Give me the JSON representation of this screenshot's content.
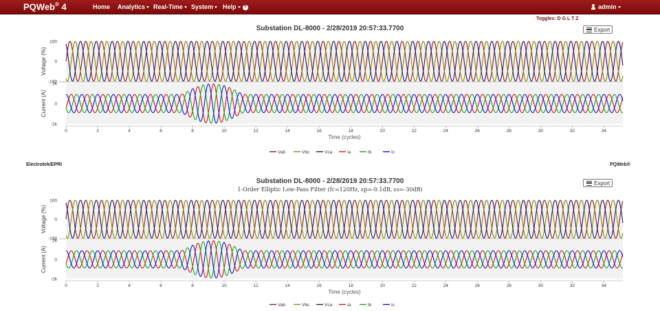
{
  "navbar": {
    "brand": "PQWeb",
    "brand_sup": "®",
    "brand_version": " 4",
    "items": [
      {
        "label": "Home",
        "dropdown": false
      },
      {
        "label": "Analytics",
        "dropdown": true
      },
      {
        "label": "Real-Time",
        "dropdown": true
      },
      {
        "label": "System",
        "dropdown": true
      },
      {
        "label": "Help",
        "dropdown": true
      }
    ],
    "user": "admin"
  },
  "toggles": "Toggles: D G L T Z",
  "footer": {
    "left": "Electrotek/EPRI",
    "right": "PQWeb®"
  },
  "colors": {
    "nav": "#8b0f0f",
    "Vab": "#8b1a1a",
    "Vbc": "#8b8b00",
    "Vca": "#1a1a66",
    "Ia": "#dd1111",
    "Ib": "#11aa11",
    "Ic": "#1111dd"
  },
  "charts": [
    {
      "title": "Substation DL-8000 - 2/28/2019 20:57:33.7700",
      "subtitle": "",
      "export_label": "Export",
      "voltage_axis_label": "Voltage (%)",
      "current_axis_label": "Current (A)",
      "voltage_ticks": [
        "100",
        "0",
        "-100"
      ],
      "current_ticks": [
        "2k",
        "0",
        "-2k"
      ],
      "x_ticks": [
        "0",
        "2",
        "4",
        "6",
        "8",
        "10",
        "12",
        "14",
        "16",
        "18",
        "20",
        "22",
        "24",
        "26",
        "28",
        "30",
        "32",
        "34"
      ],
      "x_label": "Time (cycles)",
      "legend": [
        "Vab",
        "Vbc",
        "Vca",
        "Ia",
        "Ib",
        "Ic"
      ]
    },
    {
      "title": "Substation DL-8000 - 2/28/2019 20:57:33.7700",
      "subtitle": "1-Order Elliptic Low-Pass Filter (fc=120Hz, εp=-0.1dB, εs=-30dB)",
      "export_label": "Export",
      "voltage_axis_label": "Voltage (%)",
      "current_axis_label": "Current (A)",
      "voltage_ticks": [
        "100",
        "0",
        "-100"
      ],
      "current_ticks": [
        "2k",
        "0",
        "-2k"
      ],
      "x_ticks": [
        "0",
        "2",
        "4",
        "6",
        "8",
        "10",
        "12",
        "14",
        "16",
        "18",
        "20",
        "22",
        "24",
        "26",
        "28",
        "30",
        "32",
        "34"
      ],
      "x_label": "Time (cycles)",
      "legend": [
        "Vab",
        "Vbc",
        "Vca",
        "Ia",
        "Ib",
        "Ic"
      ]
    }
  ],
  "chart_data": [
    {
      "type": "line",
      "title": "Substation DL-8000 - 2/28/2019 20:57:33.7700",
      "xlabel": "Time (cycles)",
      "x_range": [
        0,
        35.2
      ],
      "panels": [
        {
          "ylabel": "Voltage (%)",
          "ylim": [
            -100,
            100
          ],
          "series": [
            {
              "name": "Vab",
              "amplitude": 100,
              "cycles": 35.2,
              "phase_deg": 0
            },
            {
              "name": "Vbc",
              "amplitude": 100,
              "cycles": 35.2,
              "phase_deg": -120
            },
            {
              "name": "Vca",
              "amplitude": 100,
              "cycles": 35.2,
              "phase_deg": 120
            }
          ]
        },
        {
          "ylabel": "Current (A)",
          "ylim": [
            -2000,
            2000
          ],
          "series": [
            {
              "name": "Ia",
              "amplitude": 900,
              "phase_deg": -30
            },
            {
              "name": "Ib",
              "amplitude": 900,
              "phase_deg": -150
            },
            {
              "name": "Ic",
              "amplitude": 900,
              "phase_deg": 90
            }
          ],
          "fault": {
            "start_cycle": 7.3,
            "end_cycle": 11.2,
            "peak_amplitude": 1950
          }
        }
      ]
    },
    {
      "type": "line",
      "title": "Substation DL-8000 - 2/28/2019 20:57:33.7700",
      "subtitle": "1-Order Elliptic Low-Pass Filter (fc=120Hz, εp=-0.1dB, εs=-30dB)",
      "xlabel": "Time (cycles)",
      "x_range": [
        0,
        35.2
      ],
      "panels": [
        {
          "ylabel": "Voltage (%)",
          "ylim": [
            -100,
            100
          ],
          "series": [
            {
              "name": "Vab",
              "amplitude": 100,
              "cycles": 35.2,
              "phase_deg": 0
            },
            {
              "name": "Vbc",
              "amplitude": 100,
              "cycles": 35.2,
              "phase_deg": -120
            },
            {
              "name": "Vca",
              "amplitude": 100,
              "cycles": 35.2,
              "phase_deg": 120
            }
          ]
        },
        {
          "ylabel": "Current (A)",
          "ylim": [
            -2000,
            2000
          ],
          "series": [
            {
              "name": "Ia",
              "amplitude": 900,
              "phase_deg": -30
            },
            {
              "name": "Ib",
              "amplitude": 900,
              "phase_deg": -150
            },
            {
              "name": "Ic",
              "amplitude": 900,
              "phase_deg": 90
            }
          ],
          "fault": {
            "start_cycle": 7.3,
            "end_cycle": 11.2,
            "peak_amplitude": 1950
          }
        }
      ]
    }
  ]
}
